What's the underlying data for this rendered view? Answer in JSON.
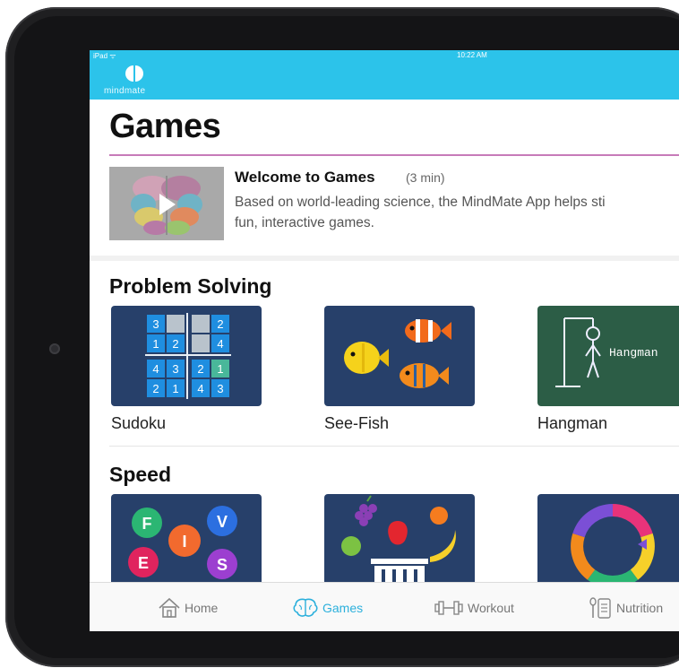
{
  "status": {
    "left": "iPad ᯤ",
    "time": "10:22 AM"
  },
  "brand": {
    "name": "mindmate"
  },
  "page": {
    "title": "Games"
  },
  "intro": {
    "title": "Welcome to Games",
    "duration": "(3 min)",
    "description_line1": "Based on world-leading science, the MindMate App helps sti",
    "description_line2": "fun, interactive games."
  },
  "sections": [
    {
      "title": "Problem Solving",
      "games": [
        {
          "label": "Sudoku"
        },
        {
          "label": "See-Fish"
        },
        {
          "label": "Hangman"
        }
      ]
    },
    {
      "title": "Speed"
    }
  ],
  "sudoku_cells": [
    "3",
    "",
    "",
    "2",
    "1",
    "2",
    "",
    "4",
    "4",
    "3",
    "2",
    "1",
    "2",
    "1",
    "4",
    "3"
  ],
  "hangman_word": "Hangman",
  "speed_letters": [
    "F",
    "V",
    "I",
    "E",
    "S"
  ],
  "tabs": [
    {
      "label": "Home",
      "icon": "home-icon",
      "active": false
    },
    {
      "label": "Games",
      "icon": "brain-icon",
      "active": true
    },
    {
      "label": "Workout",
      "icon": "dumbbell-icon",
      "active": false
    },
    {
      "label": "Nutrition",
      "icon": "nutrition-icon",
      "active": false
    }
  ],
  "colors": {
    "header": "#2cc3ea",
    "accent_rule": "#c77bb9",
    "active_tab": "#2cb0dc"
  }
}
